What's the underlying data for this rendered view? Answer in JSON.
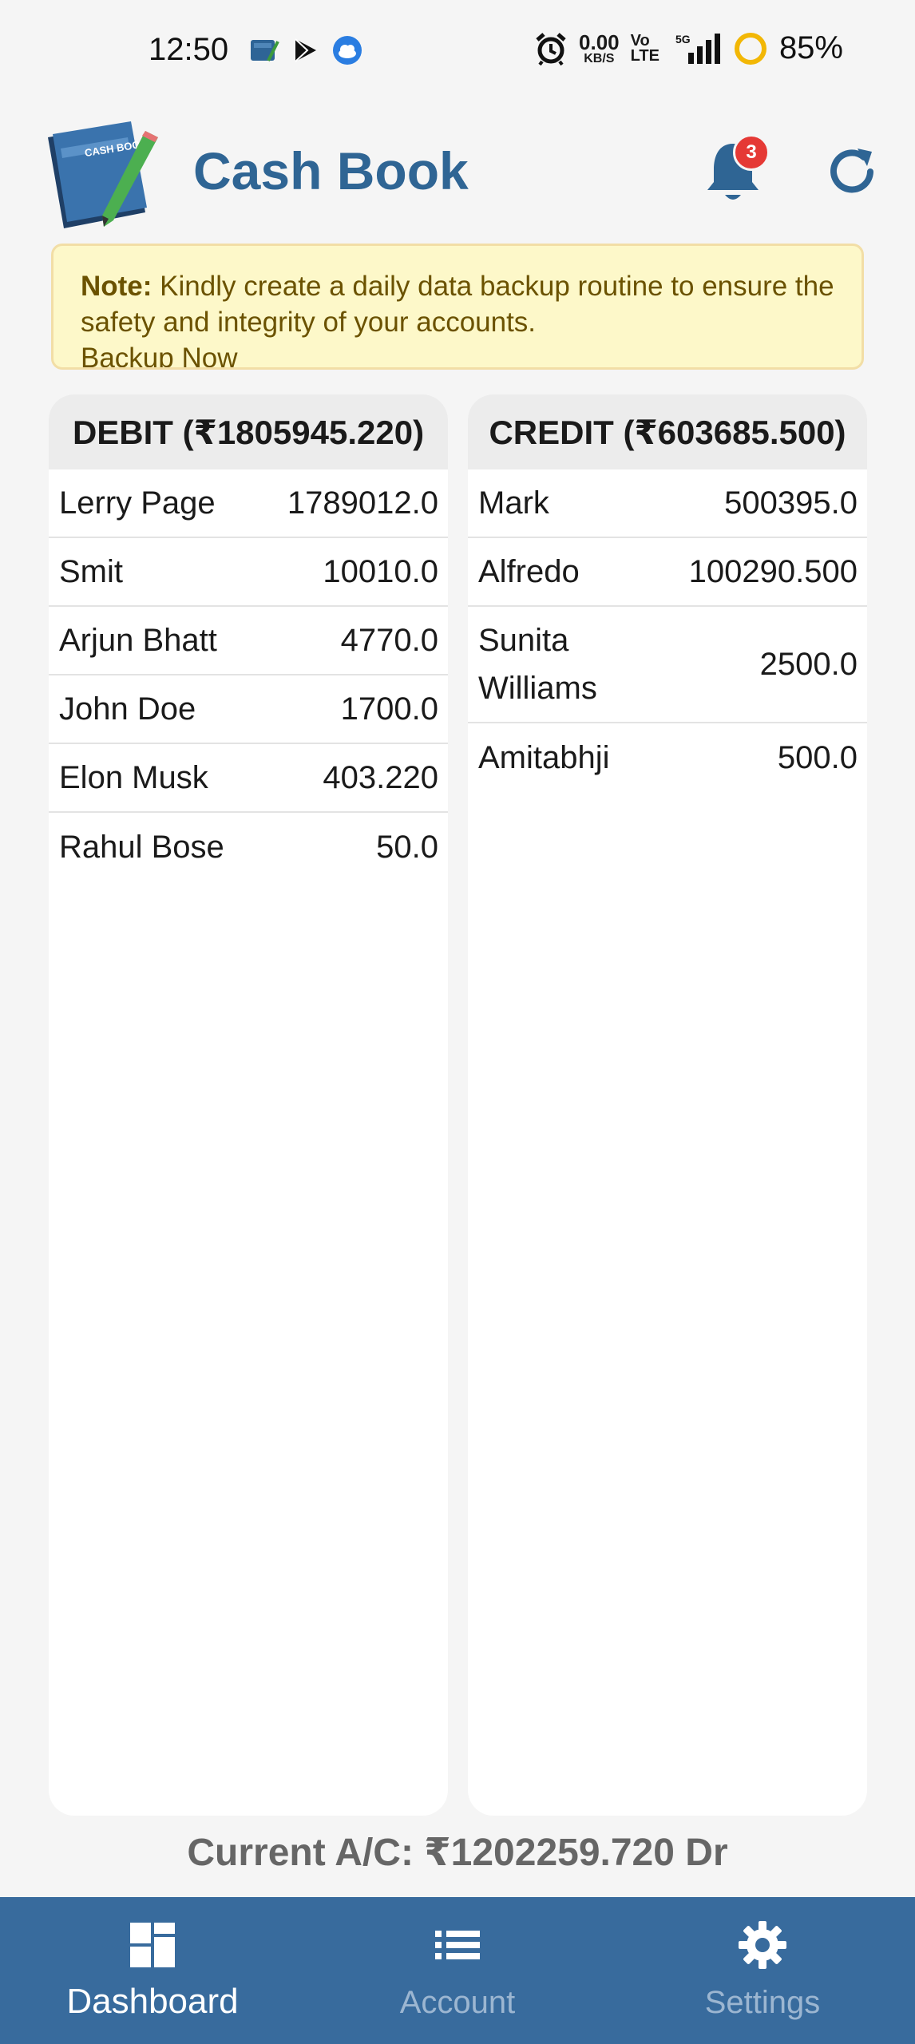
{
  "status_bar": {
    "time": "12:50",
    "net_speed_value": "0.00",
    "net_speed_unit": "KB/S",
    "volte_top": "Vo",
    "volte_bottom": "LTE",
    "signal_label": "5G",
    "battery": "85%",
    "icons": [
      "cashbook-app-icon",
      "play-store-icon",
      "weather-icon",
      "alarm-icon",
      "signal-icon",
      "battery-ring-icon"
    ]
  },
  "header": {
    "logo_text": "CASH BOOK",
    "title": "Cash Book",
    "notification_count": "3"
  },
  "note": {
    "label": "Note:",
    "text": " Kindly create a daily data backup routine to ensure the safety and integrity of your accounts.",
    "overflow_text": "Backup Now"
  },
  "debit": {
    "header": "DEBIT (₹1805945.220)",
    "rows": [
      {
        "name": "Lerry Page",
        "amount": "1789012.0"
      },
      {
        "name": "Smit",
        "amount": "10010.0"
      },
      {
        "name": "Arjun Bhatt",
        "amount": "4770.0"
      },
      {
        "name": "John Doe",
        "amount": "1700.0"
      },
      {
        "name": "Elon Musk",
        "amount": "403.220"
      },
      {
        "name": "Rahul Bose",
        "amount": "50.0"
      }
    ]
  },
  "credit": {
    "header": "CREDIT (₹603685.500)",
    "rows": [
      {
        "name": "Mark",
        "amount": "500395.0"
      },
      {
        "name": "Alfredo",
        "amount": "100290.500"
      },
      {
        "name": "Sunita Williams",
        "amount": "2500.0"
      },
      {
        "name": "Amitabhji",
        "amount": "500.0"
      }
    ]
  },
  "current_account": "Current A/C: ₹1202259.720 Dr",
  "bottom_nav": {
    "items": [
      {
        "label": "Dashboard",
        "icon": "dashboard-icon",
        "active": true
      },
      {
        "label": "Account",
        "icon": "list-icon",
        "active": false
      },
      {
        "label": "Settings",
        "icon": "gear-icon",
        "active": false
      }
    ]
  },
  "colors": {
    "brand": "#2f6594",
    "nav_bg": "#386b9d",
    "note_bg": "#fdf8c9",
    "badge": "#e53935"
  }
}
